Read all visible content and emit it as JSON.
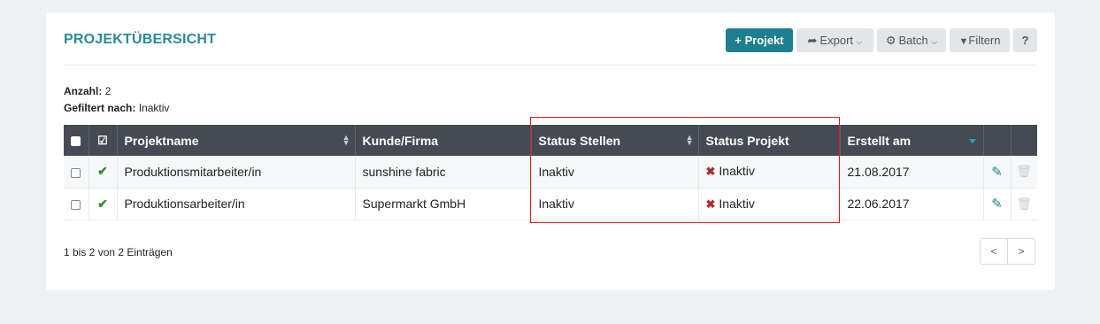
{
  "page": {
    "title": "PROJEKTÜBERSICHT"
  },
  "toolbar": {
    "new_project_label": "+ Projekt",
    "export_label": "Export",
    "batch_label": "Batch",
    "filter_label": "Filtern",
    "help_label": "?"
  },
  "summary": {
    "count_label": "Anzahl:",
    "count_value": "2",
    "filter_label": "Gefiltert nach:",
    "filter_value": "Inaktiv"
  },
  "table": {
    "columns": {
      "projektname": "Projektname",
      "kunde": "Kunde/Firma",
      "status_stellen": "Status Stellen",
      "status_projekt": "Status Projekt",
      "erstellt": "Erstellt am"
    },
    "rows": [
      {
        "projektname": "Produktionsmitarbeiter/in",
        "kunde": "sunshine fabric",
        "status_stellen": "Inaktiv",
        "status_projekt": "Inaktiv",
        "erstellt": "21.08.2017"
      },
      {
        "projektname": "Produktionsarbeiter/in",
        "kunde": "Supermarkt GmbH",
        "status_stellen": "Inaktiv",
        "status_projekt": "Inaktiv",
        "erstellt": "22.06.2017"
      }
    ]
  },
  "footer": {
    "info": "1 bis 2 von 2 Einträgen",
    "prev_label": "<",
    "next_label": ">"
  },
  "colors": {
    "accent": "#1e7f8f",
    "header_bg": "#454b55",
    "highlight": "#e01b1b",
    "active_check": "#2e8b2e",
    "inactive_x": "#b02a2a"
  },
  "icons": {
    "export": "share-arrow-icon",
    "batch": "gear-icon",
    "filter": "filter-icon",
    "edit": "pencil-icon",
    "delete": "trash-icon"
  }
}
